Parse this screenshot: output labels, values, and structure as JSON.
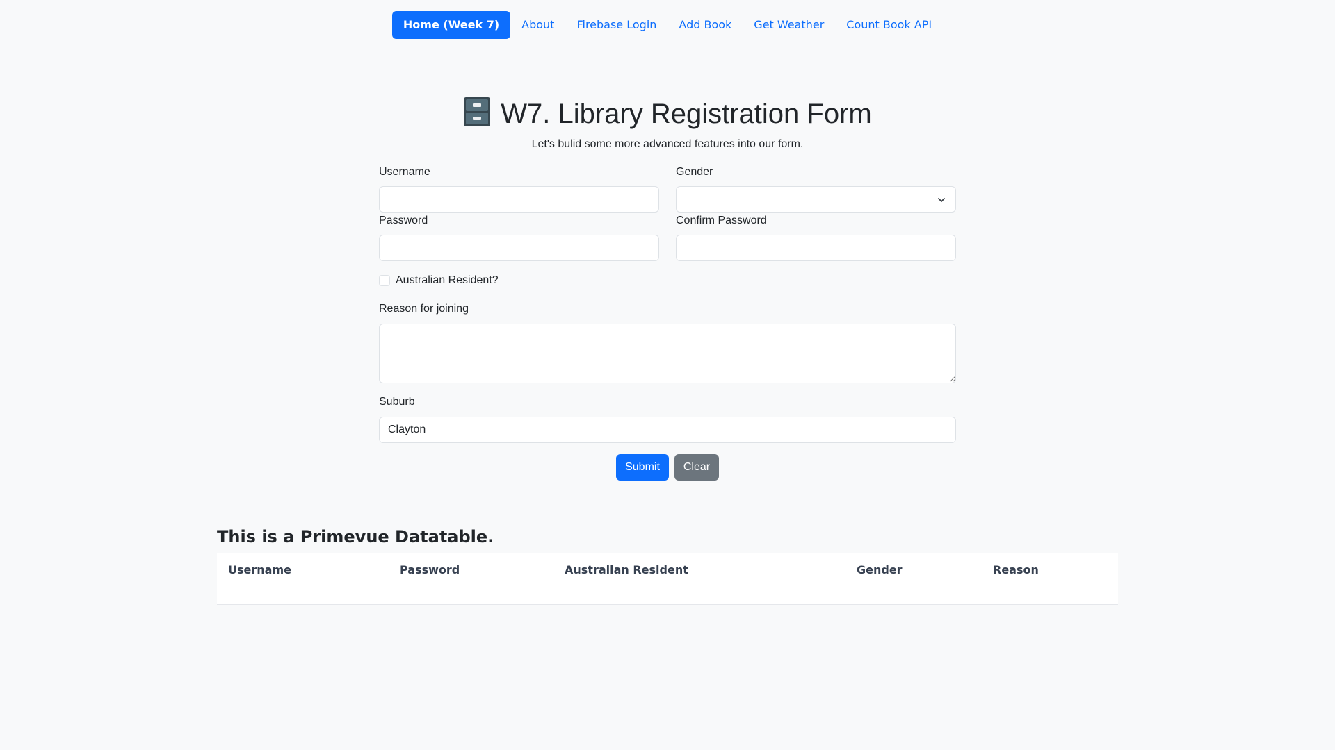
{
  "nav": {
    "items": [
      {
        "label": "Home (Week 7)",
        "active": true
      },
      {
        "label": "About"
      },
      {
        "label": "Firebase Login"
      },
      {
        "label": "Add Book"
      },
      {
        "label": "Get Weather"
      },
      {
        "label": "Count Book API"
      }
    ]
  },
  "header": {
    "icon": "file-cabinet-icon",
    "title": "W7. Library Registration Form",
    "subtitle": "Let's bulid some more advanced features into our form."
  },
  "form": {
    "username": {
      "label": "Username",
      "value": ""
    },
    "gender": {
      "label": "Gender",
      "value": ""
    },
    "password": {
      "label": "Password",
      "value": ""
    },
    "confirm_password": {
      "label": "Confirm Password",
      "value": ""
    },
    "resident": {
      "label": "Australian Resident?",
      "checked": false
    },
    "reason": {
      "label": "Reason for joining",
      "value": ""
    },
    "suburb": {
      "label": "Suburb",
      "value": "Clayton"
    },
    "submit_label": "Submit",
    "clear_label": "Clear"
  },
  "table": {
    "heading": "This is a Primevue Datatable.",
    "columns": [
      "Username",
      "Password",
      "Australian Resident",
      "Gender",
      "Reason"
    ],
    "rows": []
  },
  "colors": {
    "primary": "#0d6efd",
    "secondary": "#6c757d",
    "background": "#f8f9fa"
  }
}
